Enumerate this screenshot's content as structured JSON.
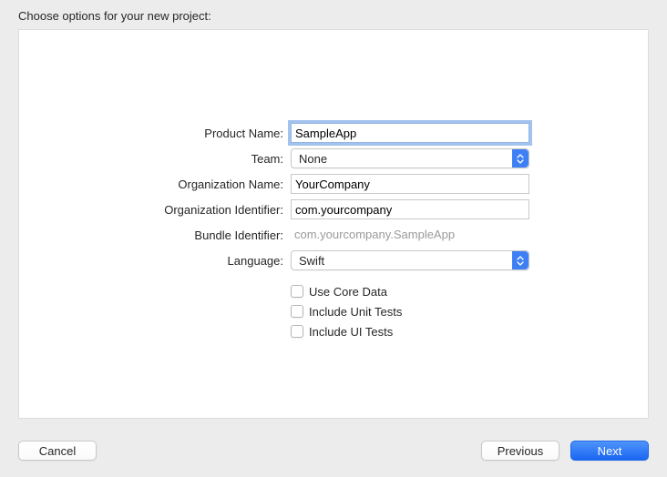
{
  "title": "Choose options for your new project:",
  "form": {
    "product_name": {
      "label": "Product Name:",
      "value": "SampleApp"
    },
    "team": {
      "label": "Team:",
      "value": "None"
    },
    "org_name": {
      "label": "Organization Name:",
      "value": "YourCompany"
    },
    "org_id": {
      "label": "Organization Identifier:",
      "value": "com.yourcompany"
    },
    "bundle_id": {
      "label": "Bundle Identifier:",
      "value": "com.yourcompany.SampleApp"
    },
    "language": {
      "label": "Language:",
      "value": "Swift"
    },
    "core_data": {
      "label": "Use Core Data",
      "checked": false
    },
    "unit_tests": {
      "label": "Include Unit Tests",
      "checked": false
    },
    "ui_tests": {
      "label": "Include UI Tests",
      "checked": false
    }
  },
  "buttons": {
    "cancel": "Cancel",
    "previous": "Previous",
    "next": "Next"
  }
}
